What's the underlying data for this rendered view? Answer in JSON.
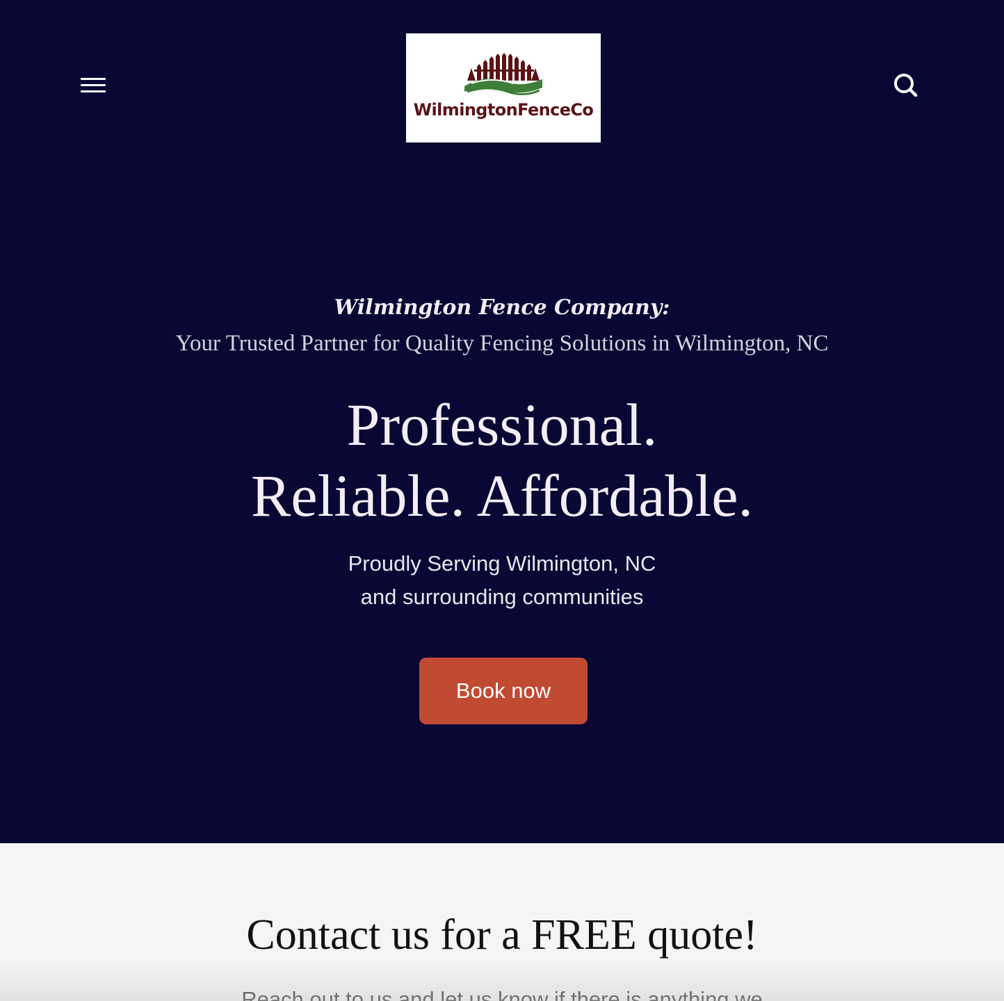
{
  "header": {
    "menu_icon": "hamburger-menu-icon",
    "search_icon": "search-icon",
    "logo_text": "WilmingtonFenceCo"
  },
  "hero": {
    "kicker": "Wilmington Fence Company:",
    "subtitle": "Your Trusted Partner for Quality Fencing Solutions in Wilmington, NC",
    "headline_line1": "Professional.",
    "headline_line2": "Reliable. Affordable.",
    "serving_line1": "Proudly Serving Wilmington, NC",
    "serving_line2": "and surrounding communities",
    "book_button": "Book now"
  },
  "contact": {
    "title": "Contact us for a FREE quote!",
    "body": "Reach out to us and let us know if there is anything we"
  },
  "colors": {
    "hero_background": "#090834",
    "button": "#c04a32",
    "logo_brown": "#5a1416",
    "logo_green": "#3f7d3a",
    "section_background": "#f5f5f5"
  }
}
